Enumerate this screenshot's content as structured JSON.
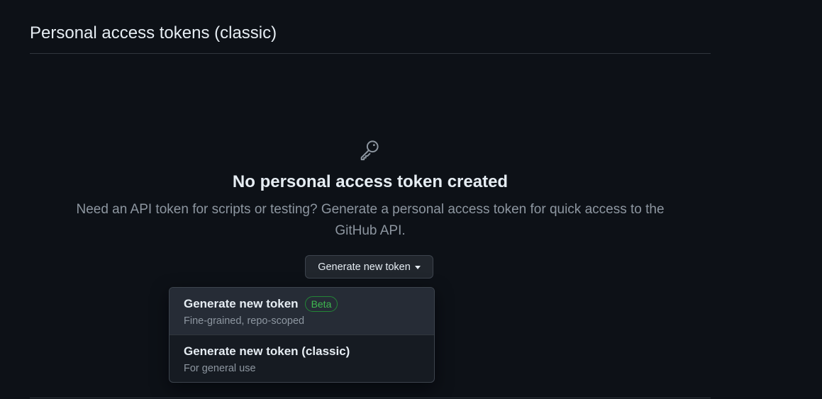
{
  "header": {
    "title": "Personal access tokens (classic)"
  },
  "blankslate": {
    "icon": "key-icon",
    "title": "No personal access token created",
    "description": "Need an API token for scripts or testing? Generate a personal access token for quick access to the GitHub API."
  },
  "generate_button": {
    "label": "Generate new token",
    "icon": "triangle-down-icon"
  },
  "dropdown": {
    "items": [
      {
        "title": "Generate new token",
        "badge": "Beta",
        "subtitle": "Fine-grained, repo-scoped"
      },
      {
        "title": "Generate new token (classic)",
        "subtitle": "For general use"
      }
    ]
  },
  "colors": {
    "background": "#0d1117",
    "text_primary": "#e6edf3",
    "text_muted": "#8d96a0",
    "border": "#30363d",
    "badge_green": "#3fb950"
  }
}
